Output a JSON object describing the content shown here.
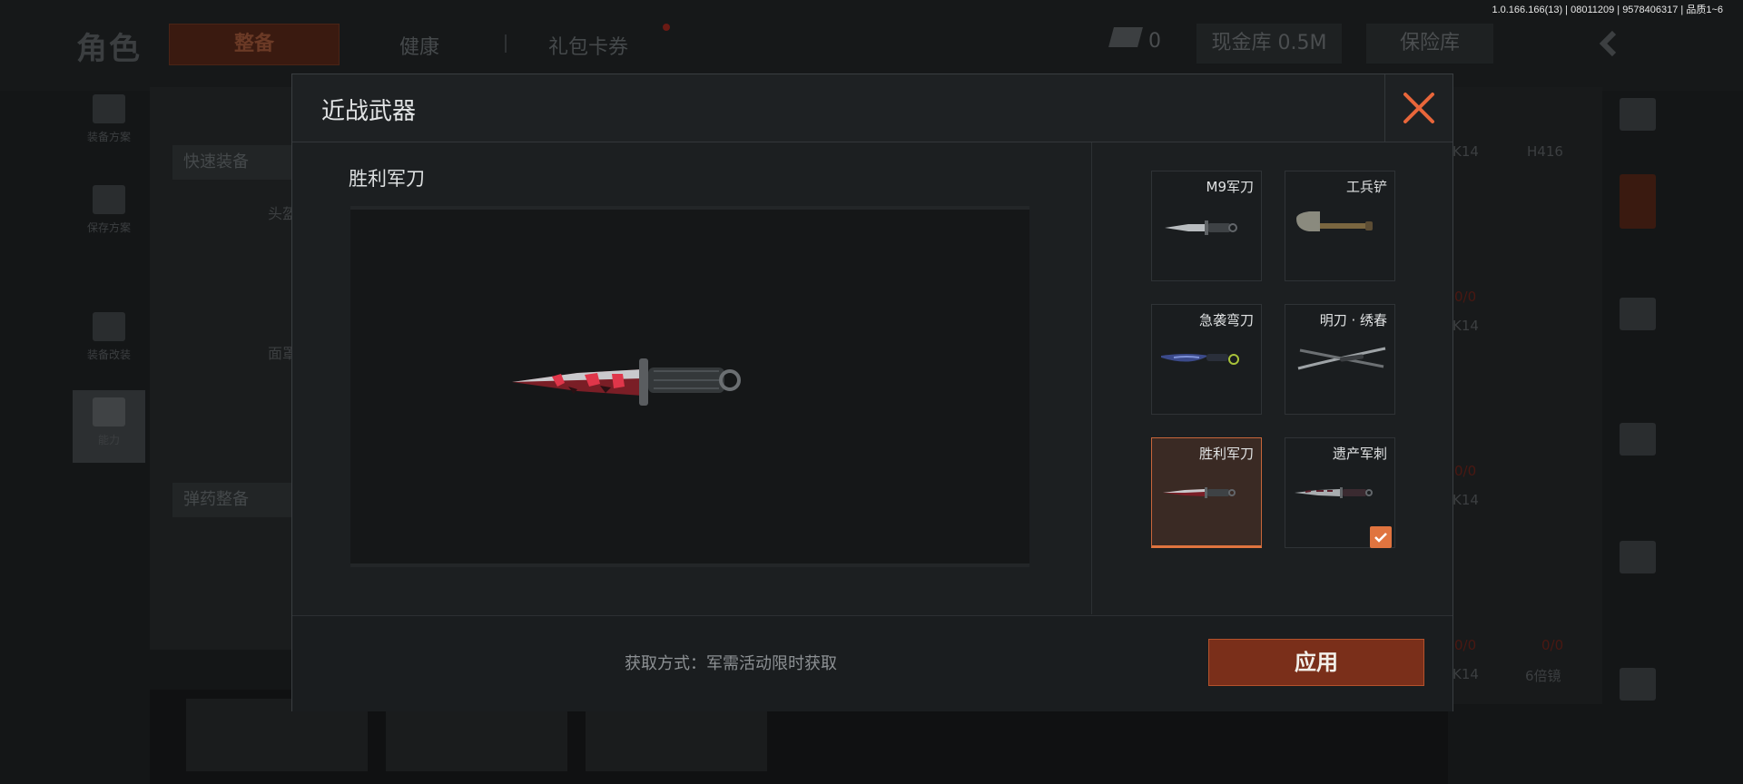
{
  "version_info": "1.0.166.166(13) | 08011209 | 9578406317 | 品质1~6",
  "background": {
    "title": "角色",
    "tabs": [
      "整备",
      "健康",
      "礼包卡券"
    ],
    "currency_count": "0",
    "cash_vault": "现金库 0.5M",
    "insurance_vault": "保险库",
    "left_nav": [
      "装备方案",
      "保存方案",
      "装备改装",
      "能力"
    ],
    "quick_equip": "快速装备",
    "ammo_equip": "弹药整备",
    "slot_labels": [
      "头盔",
      "面罩"
    ],
    "right_labels": [
      "K14",
      "H416",
      "K14",
      "K14",
      "K14",
      "6倍镜"
    ],
    "right_red": [
      "0/0",
      "0/0",
      "0/0",
      "0/0"
    ]
  },
  "modal": {
    "title": "近战武器",
    "selected_name": "胜利军刀",
    "acquire_text": "获取方式：军需活动限时获取",
    "apply_label": "应用",
    "accent_color": "#e0743f",
    "items": [
      {
        "name": "M9军刀",
        "icon": "m9-bayonet-icon"
      },
      {
        "name": "工兵铲",
        "icon": "shovel-icon"
      },
      {
        "name": "急袭弯刀",
        "icon": "karambit-icon"
      },
      {
        "name": "明刀 · 绣春",
        "icon": "ming-sabre-icon"
      },
      {
        "name": "胜利军刀",
        "icon": "victory-bayonet-icon",
        "selected": true
      },
      {
        "name": "遗产军刺",
        "icon": "legacy-bayonet-icon",
        "equipped": true
      }
    ]
  }
}
